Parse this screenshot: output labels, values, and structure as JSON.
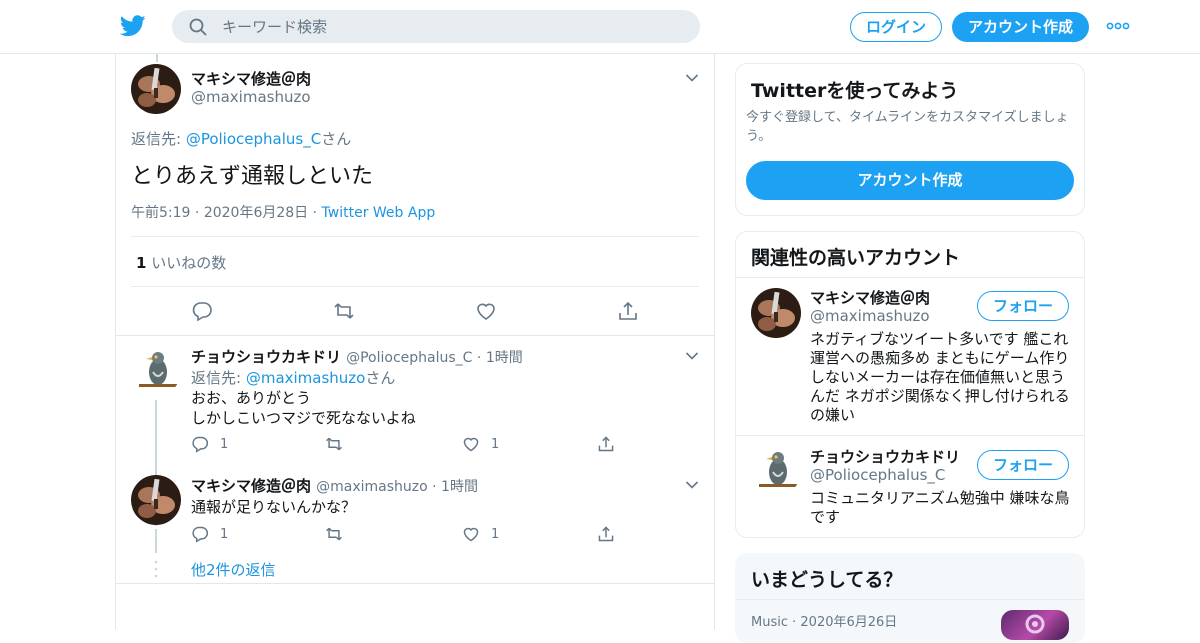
{
  "header": {
    "search_placeholder": "キーワード検索",
    "login_label": "ログイン",
    "signup_label": "アカウント作成"
  },
  "main_tweet": {
    "name": "マキシマ修造＠肉",
    "handle": "@maximashuzo",
    "reply_prefix": "返信先: ",
    "reply_to": "@Poliocephalus_C",
    "reply_suffix": "さん",
    "text": "とりあえず通報しといた",
    "time": "午前5:19",
    "date": "2020年6月28日",
    "source": "Twitter Web App",
    "likes_count": "1",
    "likes_label": "いいねの数"
  },
  "replies": [
    {
      "name": "チョウショウカキドリ",
      "handle": "@Poliocephalus_C",
      "time": "1時間",
      "reply_prefix": "返信先: ",
      "reply_to": "@maximashuzo",
      "reply_suffix": "さん",
      "line1": "おお、ありがとう",
      "line2": "しかしこいつマジで死なないよね",
      "reply_count": "1",
      "like_count": "1"
    },
    {
      "name": "マキシマ修造＠肉",
      "handle": "@maximashuzo",
      "time": "1時間",
      "text": "通報が足りないんかな？",
      "reply_count": "1",
      "like_count": "1"
    }
  ],
  "more_replies_label": "他2件の返信",
  "sidebar": {
    "signup_card": {
      "title": "Twitterを使ってみよう",
      "description": "今すぐ登録して、タイムラインをカスタマイズしましょう。",
      "button_label": "アカウント作成"
    },
    "related": {
      "title": "関連性の高いアカウント",
      "follow_label": "フォロー",
      "accounts": [
        {
          "name": "マキシマ修造＠肉",
          "handle": "@maximashuzo",
          "bio": "ネガティブなツイート多いです 艦これ運営への愚痴多め まともにゲーム作りしないメーカーは存在価値無いと思うんだ ネガポジ関係なく押し付けられるの嫌い"
        },
        {
          "name": "チョウショウカキドリ",
          "handle": "@Poliocephalus_C",
          "bio": "コミュニタリアニズム勉強中 嫌味な鳥です"
        }
      ]
    },
    "trends": {
      "title": "いまどうしてる？",
      "item_category": "Music",
      "item_date": "2020年6月26日"
    }
  },
  "colors": {
    "accent": "#1da1f2",
    "link": "#1b95e0",
    "muted": "#657786",
    "border": "#e6ecf0"
  }
}
